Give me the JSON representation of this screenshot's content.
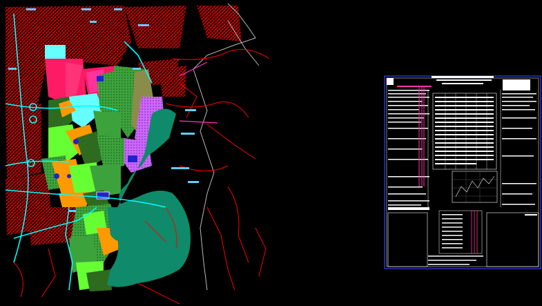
{
  "app": {
    "view": "cad-model-space",
    "background": "#000000"
  },
  "layers": {
    "roads": "#ff0000",
    "water": "#00ffff",
    "boundary": "#cccccc",
    "reservoir": "#0f8a6a",
    "landuse_pink": "#ff1a66",
    "landuse_green": "#3ca33c",
    "landuse_dark_green": "#2e6b1f",
    "landuse_orange": "#ff9900",
    "landuse_lime": "#66ff33",
    "landuse_violet": "#cc66ff",
    "landuse_olive": "#8c8c4a",
    "landuse_cyan": "#66ffff",
    "landuse_blue": "#2222cc",
    "sheet_frame": "#3344ff",
    "sheet_text": "#ffffff",
    "sheet_accent": "#ff33aa"
  },
  "map": {
    "name": "site-plan-drawing"
  },
  "sheet": {
    "name": "data-table-sheet"
  }
}
